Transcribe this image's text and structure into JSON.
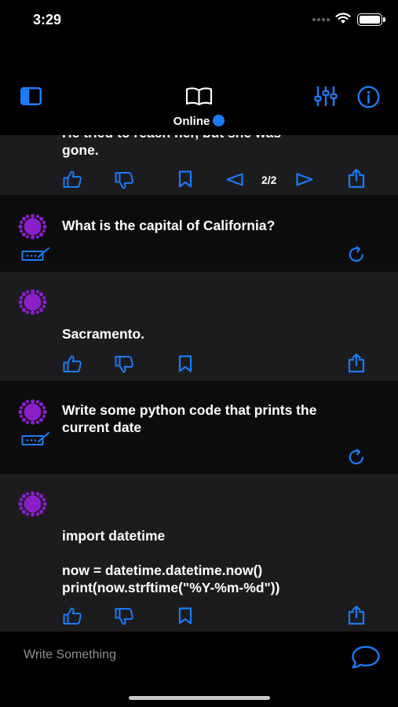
{
  "status_bar": {
    "time": "3:29"
  },
  "header": {
    "status_label": "Online"
  },
  "messages": [
    {
      "role": "ai",
      "partial_text": "He tried to reach her, but she was",
      "text": "gone.",
      "page_indicator": "2/2"
    },
    {
      "role": "user",
      "text": "What is the capital of California?"
    },
    {
      "role": "ai",
      "text": "Sacramento."
    },
    {
      "role": "user",
      "text": "Write some python code that prints the\ncurrent date"
    },
    {
      "role": "ai",
      "text": "import datetime\n\nnow = datetime.datetime.now()\nprint(now.strftime(\"%Y-%m-%d\"))"
    }
  ],
  "composer": {
    "placeholder": "Write Something"
  },
  "colors": {
    "accent": "#1a7cf5",
    "avatar": "#8a1ec8",
    "ai_bubble": "#1c1c1e",
    "user_bubble": "#0c0c0c"
  }
}
